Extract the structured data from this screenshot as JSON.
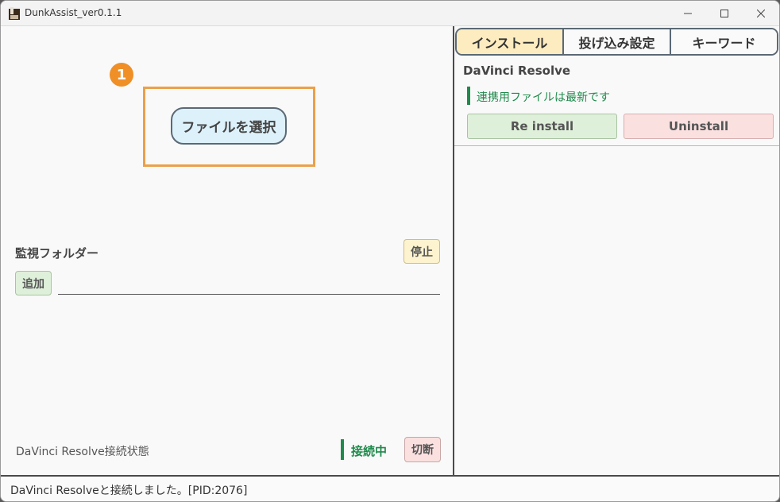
{
  "window": {
    "title": "DunkAssist_ver0.1.1"
  },
  "left": {
    "step_badge": "1",
    "file_select_label": "ファイルを選択",
    "watch_folder_label": "監視フォルダー",
    "stop_label": "停止",
    "add_label": "追加",
    "folder_path_value": "",
    "connection_label": "DaVinci Resolve接続状態",
    "connection_status": "接続中",
    "disconnect_label": "切断"
  },
  "right": {
    "tabs": [
      {
        "label": "インストール",
        "active": true
      },
      {
        "label": "投げ込み設定",
        "active": false
      },
      {
        "label": "キーワード",
        "active": false
      }
    ],
    "app_name": "DaVinci Resolve",
    "status_message": "連携用ファイルは最新です",
    "reinstall_label": "Re install",
    "uninstall_label": "Uninstall"
  },
  "footer": {
    "message": "DaVinci Resolveと接続しました。[PID:2076]"
  },
  "colors": {
    "accent_orange": "#ef8f26",
    "status_green": "#1f8a4c",
    "tab_active": "#fcecbf"
  }
}
